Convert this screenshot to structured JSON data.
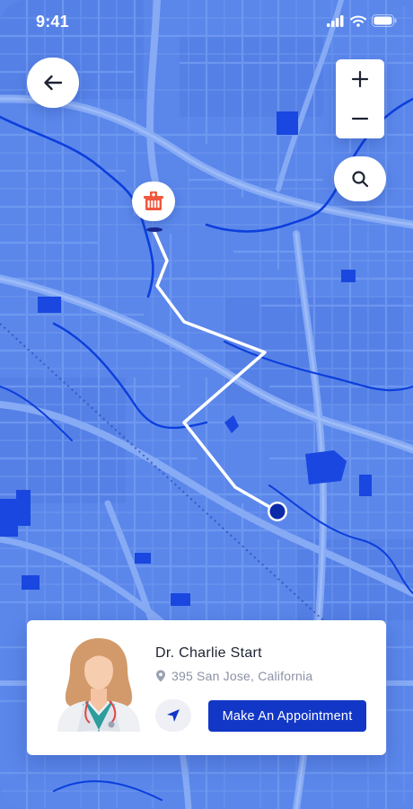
{
  "status_bar": {
    "time": "9:41"
  },
  "doctor": {
    "name": "Dr. Charlie Start",
    "address": "395 San Jose, California"
  },
  "actions": {
    "appointment_label": "Make An Appointment"
  },
  "icons": {
    "back": "arrow-left-icon",
    "zoom_in": "plus-icon",
    "zoom_out": "minus-icon",
    "search": "search-icon",
    "hospital": "hospital-icon",
    "location": "location-pin-icon",
    "navigate": "navigation-arrow-icon"
  },
  "colors": {
    "map_base": "#5b87eb",
    "map_road": "#7aa0f2",
    "map_water": "#0c3fdc",
    "route": "#ffffff",
    "destination": "#0a2aa8",
    "hospital_pin": "#f0573f",
    "primary_button": "#1237c7"
  }
}
